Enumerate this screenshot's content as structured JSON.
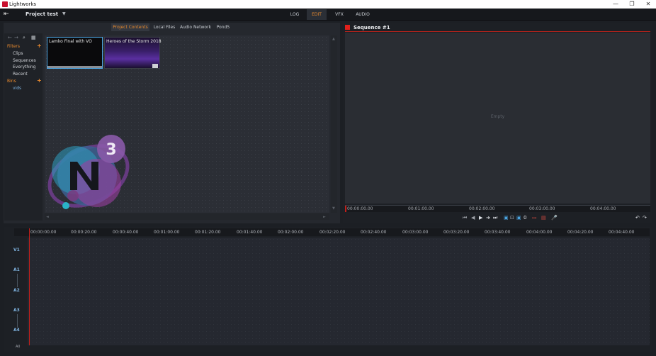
{
  "window": {
    "title": "Lightworks",
    "minimize": "—",
    "maximize": "❐",
    "close": "✕"
  },
  "appbar": {
    "exit_icon": "⇤",
    "project_name": "Project test",
    "project_dropdown": "▼",
    "modes": [
      "LOG",
      "EDIT",
      "VFX",
      "AUDIO"
    ],
    "active_mode": "EDIT"
  },
  "project_panel": {
    "tabs": [
      "Project Contents",
      "Local Files",
      "Audio Network",
      "Pond5"
    ],
    "active_tab": "Project Contents",
    "toolbar_icons": [
      "←",
      "→",
      "⌕",
      "▦"
    ],
    "filters_label": "Filters",
    "filters_add": "+",
    "filters": [
      "Clips",
      "Sequences",
      "Everything",
      "Recent"
    ],
    "bins_label": "Bins",
    "bins_add": "+",
    "bins": [
      "vids"
    ],
    "tiles": [
      {
        "name": "Lamko Final with VO"
      },
      {
        "name": "Heroes of the Storm 2018"
      }
    ],
    "scroll_up": "▲",
    "scroll_down": "▼",
    "scroll_left": "◄",
    "scroll_right": "►"
  },
  "viewer": {
    "title": "Sequence #1",
    "status": "Empty",
    "timecodes": [
      "00:00:00.00",
      "00:01:00.00",
      "00:02:00.00",
      "00:03:00.00",
      "00:04:00.00"
    ],
    "controls": [
      "⏮",
      "◀",
      "▶",
      "➜",
      "⏭",
      "▣",
      "⊡",
      "▣",
      "0",
      "▭",
      "▤",
      "🎤",
      "↶",
      "↷"
    ]
  },
  "timeline": {
    "icons": [
      "⊕",
      "⊖"
    ],
    "timecodes": [
      "00:00:00.00",
      "00:00:20.00",
      "00:00:40.00",
      "00:01:00.00",
      "00:01:20.00",
      "00:01:40.00",
      "00:02:00.00",
      "00:02:20.00",
      "00:02:40.00",
      "00:03:00.00",
      "00:03:20.00",
      "00:03:40.00",
      "00:04:00.00",
      "00:04:20.00",
      "00:04:40.00"
    ],
    "tracks": [
      "V1",
      "A1",
      "A2",
      "A3",
      "A4"
    ],
    "all_label": "All"
  },
  "colors": {
    "accent": "#e88a2e",
    "playhead": "#c21f1a",
    "track_label": "#7fb3e0",
    "selected_border": "#4aa3df"
  }
}
